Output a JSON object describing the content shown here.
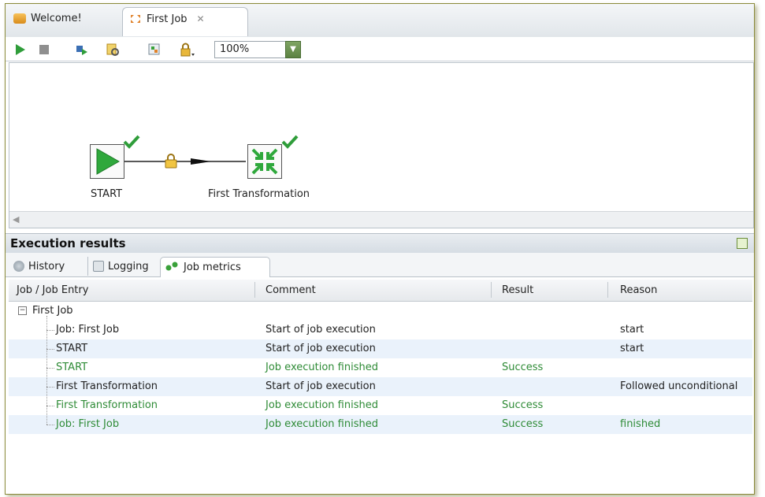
{
  "tabs": [
    {
      "label": "Welcome!",
      "icon": "welcome-icon",
      "active": false
    },
    {
      "label": "First Job",
      "icon": "job-icon",
      "active": true,
      "closable": true
    }
  ],
  "toolbar": {
    "zoom_value": "100%",
    "buttons": [
      "run-icon",
      "stop-icon",
      "replay-icon",
      "check-icon",
      "impact-icon",
      "lock-icon"
    ]
  },
  "canvas": {
    "nodes": [
      {
        "label": "START",
        "icon": "start-icon",
        "status": "success"
      },
      {
        "label": "First Transformation",
        "icon": "transformation-icon",
        "status": "success"
      }
    ],
    "hop": {
      "type": "unconditional",
      "icon": "lock-icon"
    }
  },
  "execution": {
    "title": "Execution results",
    "tabs": [
      {
        "label": "History",
        "icon": "history-icon"
      },
      {
        "label": "Logging",
        "icon": "logging-icon"
      },
      {
        "label": "Job metrics",
        "icon": "metrics-icon",
        "active": true
      }
    ],
    "columns": [
      "Job / Job Entry",
      "Comment",
      "Result",
      "Reason"
    ],
    "root": "First Job",
    "rows": [
      {
        "entry": "Job: First Job",
        "comment": "Start of job execution",
        "result": "",
        "reason": "start",
        "green": false
      },
      {
        "entry": "START",
        "comment": "Start of job execution",
        "result": "",
        "reason": "start",
        "green": false
      },
      {
        "entry": "START",
        "comment": "Job execution finished",
        "result": "Success",
        "reason": "",
        "green": true
      },
      {
        "entry": "First Transformation",
        "comment": "Start of job execution",
        "result": "",
        "reason": "Followed unconditional",
        "green": false
      },
      {
        "entry": "First Transformation",
        "comment": "Job execution finished",
        "result": "Success",
        "reason": "",
        "green": true
      },
      {
        "entry": "Job: First Job",
        "comment": "Job execution finished",
        "result": "Success",
        "reason": "finished",
        "green": true
      }
    ]
  },
  "colors": {
    "success_green": "#2e8b36",
    "row_alt": "#eaf2fb",
    "accent_green": "#3aa13a"
  }
}
